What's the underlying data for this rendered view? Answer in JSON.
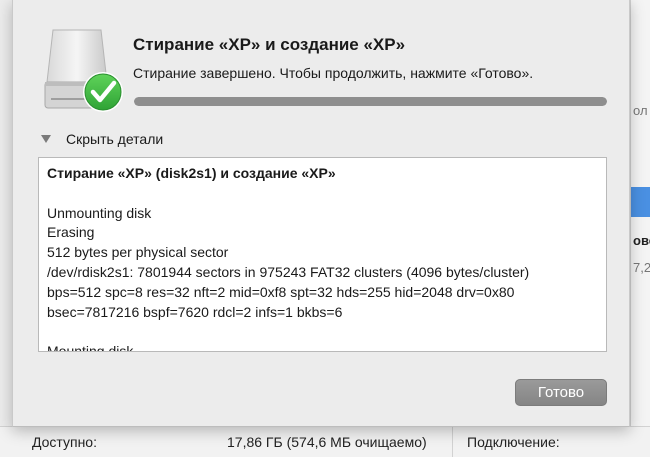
{
  "background": {
    "right_fragments": [
      "ол",
      "ове",
      "7,2"
    ],
    "bottom": {
      "available_label": "Доступно:",
      "available_value": "17,86 ГБ (574,6 МБ очищаемо)",
      "connection_label": "Подключение:"
    }
  },
  "dialog": {
    "title": "Стирание «XP» и создание «XP»",
    "subtitle": "Стирание завершено. Чтобы продолжить, нажмите «Готово».",
    "progress_fraction": 1.0,
    "details_toggle_label": "Скрыть детали",
    "log_lines": [
      "Стирание «XP» (disk2s1) и создание «XP»",
      "",
      "Unmounting disk",
      "Erasing",
      "512 bytes per physical sector",
      "/dev/rdisk2s1: 7801944 sectors in 975243 FAT32 clusters (4096 bytes/cluster)",
      "bps=512 spc=8 res=32 nft=2 mid=0xf8 spt=32 hds=255 hid=2048 drv=0x80",
      "bsec=7817216 bspf=7620 rdcl=2 infs=1 bkbs=6",
      "",
      "Mounting disk"
    ],
    "done_button_label": "Готово"
  },
  "icons": [
    "disk-icon",
    "checkmark-badge-icon",
    "disclosure-triangle-icon"
  ],
  "colors": {
    "check_green": "#3cb83f",
    "accent_blue": "#4a90e2"
  }
}
